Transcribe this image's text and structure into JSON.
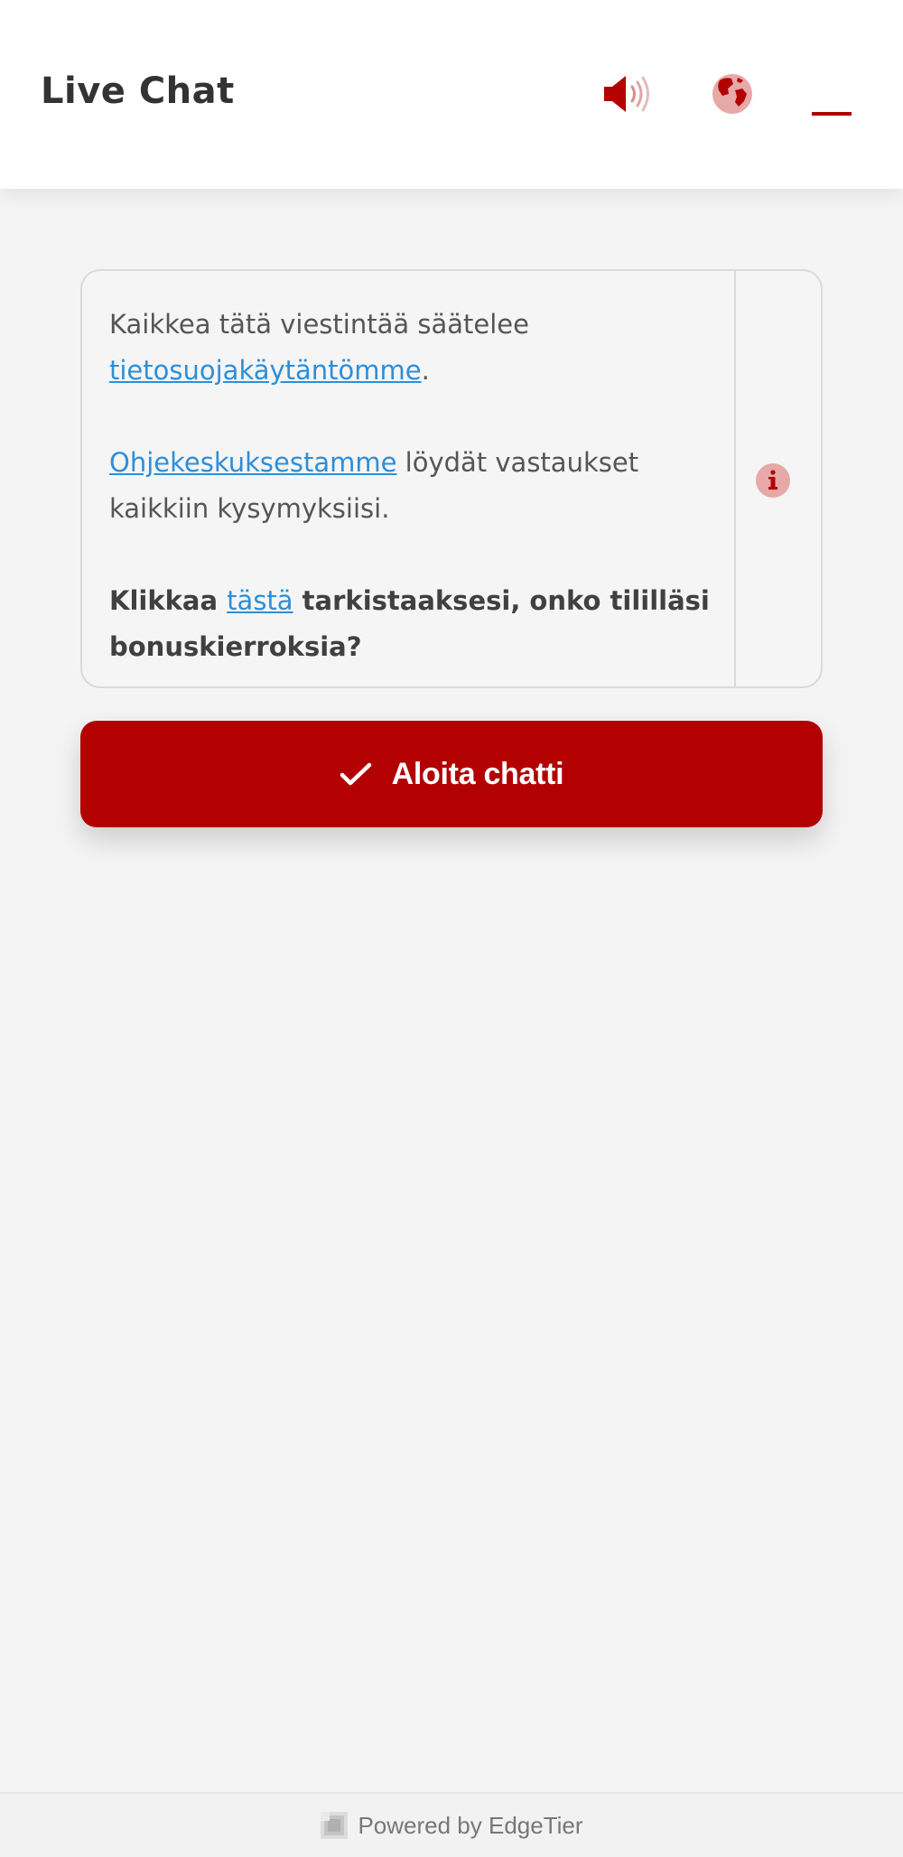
{
  "header": {
    "title": "Live Chat",
    "sound_icon": "speaker-icon",
    "language_icon": "globe-icon",
    "minimize_icon": "minimize-icon"
  },
  "info": {
    "line1_prefix": "Kaikkea tätä viestintää säätelee",
    "privacy_link": "tietosuojakäytäntömme",
    "line1_suffix": ".",
    "help_link": "Ohjekeskuksestamme",
    "help_suffix": " löydät vastaukset kaikkiin kysymyksiisi.",
    "bonus_prefix": "Klikkaa ",
    "bonus_link": "tästä",
    "bonus_suffix": "  tarkistaaksesi, onko tililläsi bonuskierroksia?",
    "info_icon": "info-icon"
  },
  "start_button": {
    "label": "Aloita chatti",
    "icon": "check-icon"
  },
  "footer": {
    "powered": "Powered by EdgeTier",
    "logo_icon": "edgetier-logo-icon"
  },
  "colors": {
    "accent": "#b30000",
    "link": "#2e8ed8",
    "background": "#f4f4f4",
    "header_bg": "#ffffff"
  }
}
